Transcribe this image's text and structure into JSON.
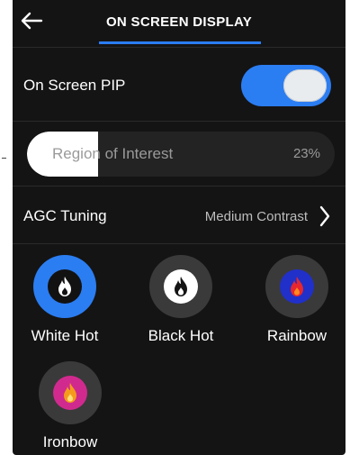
{
  "header": {
    "title": "ON SCREEN DISPLAY",
    "back_icon": "arrow-left-icon"
  },
  "pip": {
    "label": "On Screen PIP",
    "enabled": true
  },
  "roi": {
    "label": "Region of Interest",
    "value_text": "23%",
    "value_fraction": 0.23
  },
  "agc": {
    "label": "AGC Tuning",
    "value": "Medium Contrast",
    "chevron_icon": "chevron-right-icon"
  },
  "palettes": [
    {
      "name": "White Hot",
      "selected": true,
      "icon": "flame-icon"
    },
    {
      "name": "Black Hot",
      "selected": false,
      "icon": "flame-icon"
    },
    {
      "name": "Rainbow",
      "selected": false,
      "icon": "flame-icon"
    },
    {
      "name": "Ironbow",
      "selected": false,
      "icon": "flame-icon"
    }
  ],
  "colors": {
    "accent": "#2b7df2",
    "background": "#141414",
    "text": "#ffffff",
    "muted_text": "#9a9a9a"
  }
}
